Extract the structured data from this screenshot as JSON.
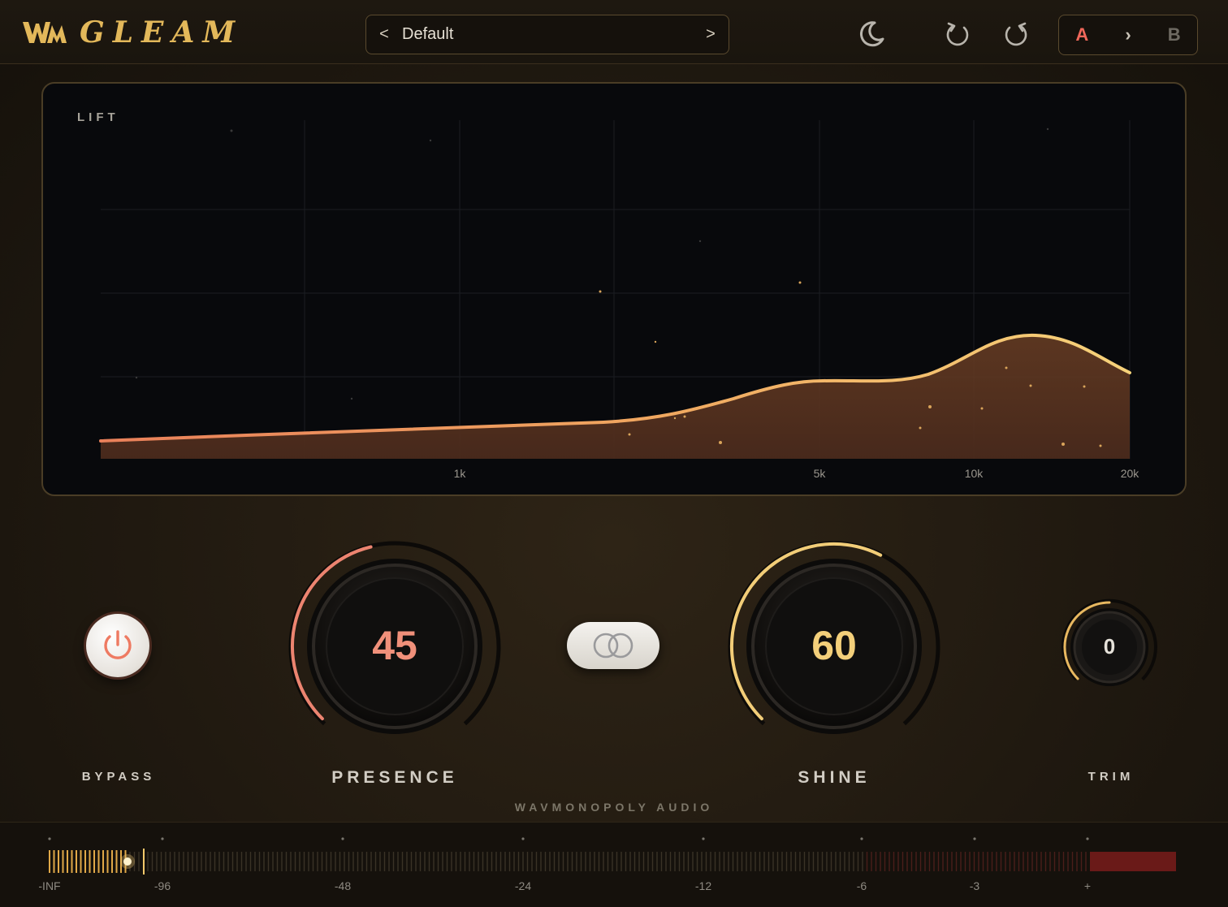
{
  "header": {
    "logo_mark": "WM",
    "logo_text": "GLEAM",
    "preset": {
      "prev_label": "<",
      "name": "Default",
      "next_label": ">"
    },
    "ab": {
      "a_label": "A",
      "arrow_label": "›",
      "b_label": "B"
    }
  },
  "graph": {
    "title": "LIFT",
    "freq_labels": [
      "1k",
      "5k",
      "10k",
      "20k"
    ]
  },
  "controls": {
    "bypass_label": "BYPASS",
    "presence": {
      "label": "PRESENCE",
      "value": "45",
      "level": 0.45,
      "color": "#f0907a"
    },
    "shine": {
      "label": "SHINE",
      "value": "60",
      "level": 0.6,
      "color": "#f3cf7a"
    },
    "trim": {
      "label": "TRIM",
      "value": "0",
      "level": 0.5
    }
  },
  "brand": "WAVMONOPOLY AUDIO",
  "meter": {
    "scale_labels": [
      "-INF",
      "-96",
      "-48",
      "-24",
      "-12",
      "-6",
      "-3",
      "+"
    ]
  },
  "colors": {
    "accent_gold": "#e3b85a",
    "accent_red": "#f0675a",
    "curve": "#f0b060"
  }
}
